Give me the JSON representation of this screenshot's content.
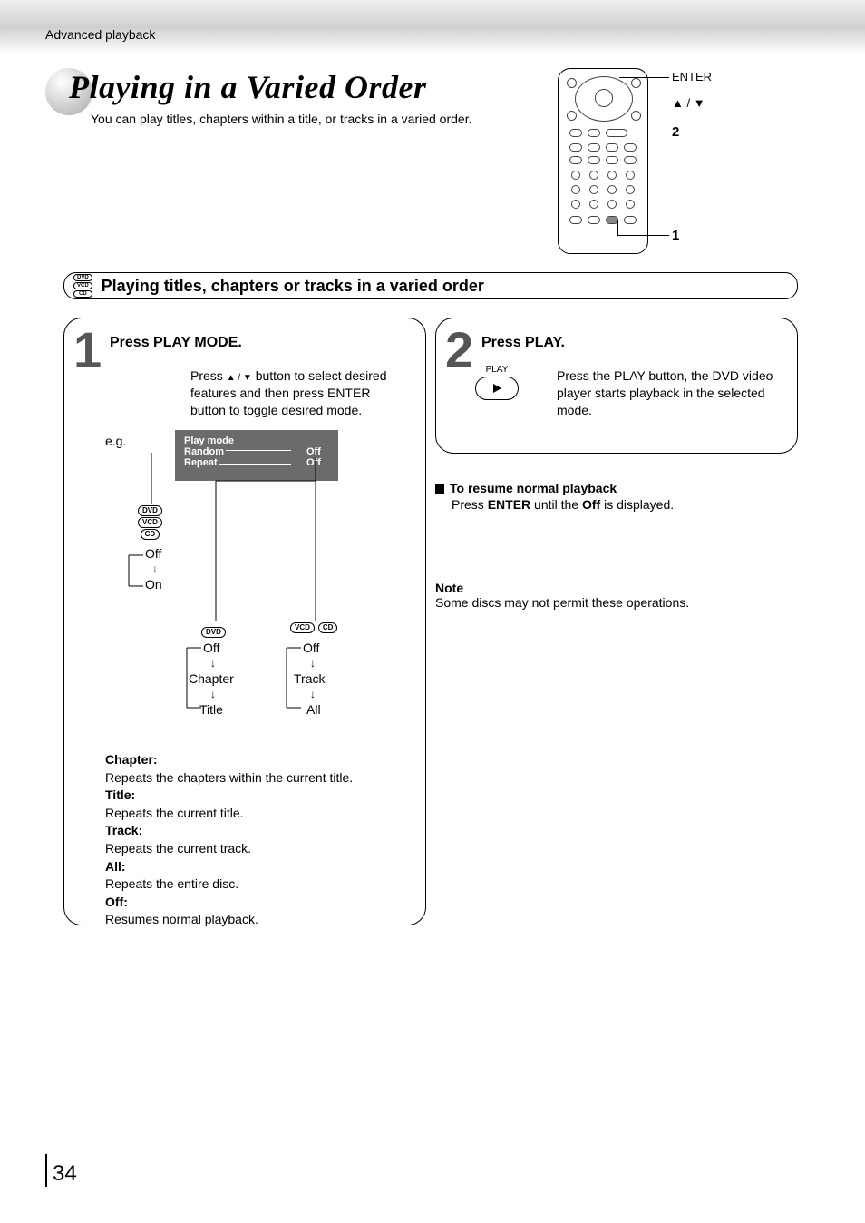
{
  "header": {
    "breadcrumb": "Advanced playback"
  },
  "title": {
    "main": "Playing in a Varied Order",
    "sub": "You can play titles, chapters within a title, or tracks in a varied order."
  },
  "remote": {
    "callout_enter": "ENTER",
    "callout_nav": "▲ / ▼",
    "callout_2": "2",
    "callout_1": "1"
  },
  "section": {
    "badges": [
      "DVD",
      "VCD",
      "CD"
    ],
    "title": "Playing titles, chapters or tracks in a varied order"
  },
  "step1": {
    "title": "Press PLAY MODE.",
    "instruction_pre": "Press ",
    "instruction_mid": " button to select desired features and then press ENTER button to toggle desired mode.",
    "nav_symbols": "▲ / ▼",
    "eg": "e.g.",
    "osd": {
      "header": "Play mode",
      "row1_label": "Random",
      "row1_val": "Off",
      "row2_label": "Repeat",
      "row2_val": "Off"
    },
    "random_branch": {
      "badges": [
        "DVD",
        "VCD",
        "CD"
      ],
      "item1": "Off",
      "item2": "On"
    },
    "repeat_dvd": {
      "badge": "DVD",
      "item1": "Off",
      "item2": "Chapter",
      "item3": "Title"
    },
    "repeat_vcd_cd": {
      "badge1": "VCD",
      "badge2": "CD",
      "item1": "Off",
      "item2": "Track",
      "item3": "All"
    },
    "defs": {
      "chapter_h": "Chapter:",
      "chapter_t": "Repeats the chapters within the current title.",
      "title_h": "Title:",
      "title_t": "Repeats the current title.",
      "track_h": "Track:",
      "track_t": "Repeats the current track.",
      "all_h": "All:",
      "all_t": "Repeats the entire disc.",
      "off_h": "Off:",
      "off_t": "Resumes normal playback."
    }
  },
  "step2": {
    "title": "Press PLAY.",
    "play_label": "PLAY",
    "body": "Press the PLAY button, the DVD video player starts playback in the selected mode."
  },
  "resume": {
    "heading": "To resume normal playback",
    "line_pre": "Press ",
    "enter": "ENTER",
    "line_mid": " until the ",
    "off": "Off",
    "line_post": " is displayed."
  },
  "note": {
    "heading": "Note",
    "body": "Some discs may not permit these operations."
  },
  "page_number": "34"
}
